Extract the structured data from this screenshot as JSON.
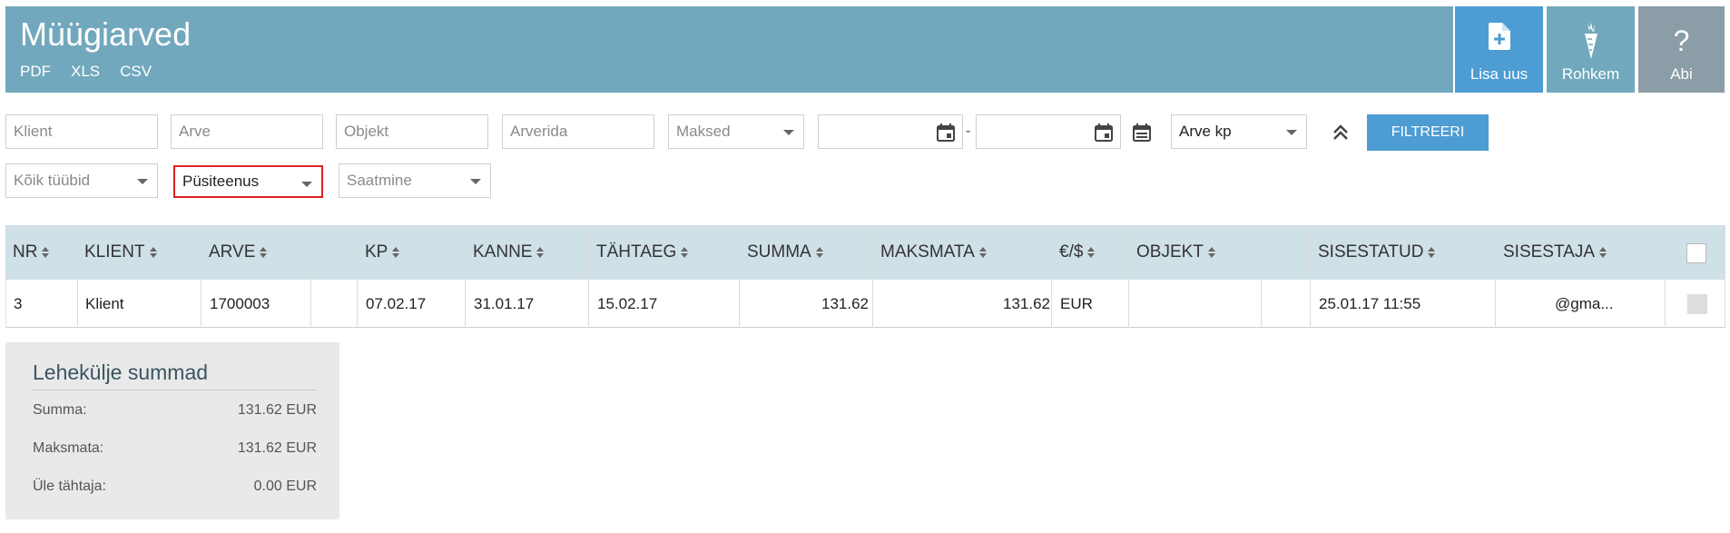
{
  "header": {
    "title": "Müügiarved",
    "exports": [
      "PDF",
      "XLS",
      "CSV"
    ],
    "buttons": {
      "add": "Lisa uus",
      "more": "Rohkem",
      "help": "Abi",
      "help_icon": "?"
    }
  },
  "filters": {
    "klient_placeholder": "Klient",
    "arve_placeholder": "Arve",
    "objekt_placeholder": "Objekt",
    "arverida_placeholder": "Arverida",
    "maksed": "Maksed",
    "date_separator": "-",
    "date_type": "Arve kp",
    "submit": "FILTREERI",
    "type": "Kõik tüübid",
    "service": "Püsiteenus",
    "saatmine": "Saatmine"
  },
  "table": {
    "columns": [
      "NR",
      "KLIENT",
      "ARVE",
      "",
      "KP",
      "KANNE",
      "TÄHTAEG",
      "SUMMA",
      "MAKSMATA",
      "€/$",
      "OBJEKT",
      "",
      "SISESTATUD",
      "SISESTAJA"
    ],
    "row": {
      "nr": "3",
      "klient": "Klient",
      "arve": "1700003",
      "kp": "07.02.17",
      "kanne": "31.01.17",
      "tahtaeg": "15.02.17",
      "summa": "131.62",
      "maksmata": "131.62",
      "valuuta": "EUR",
      "objekt": "",
      "sisestatud": "25.01.17 11:55",
      "sisestaja": "@gma..."
    }
  },
  "summary": {
    "title": "Lehekülje summad",
    "rows": [
      {
        "label": "Summa:",
        "value": "131.62 EUR"
      },
      {
        "label": "Maksmata:",
        "value": "131.62 EUR"
      },
      {
        "label": "Üle tähtaja:",
        "value": "0.00 EUR"
      }
    ]
  },
  "colors": {
    "header_bg": "#72a8bd",
    "add_button": "#4d9cd3",
    "help_button": "#8b9da6",
    "table_header_bg": "#cfe0e7",
    "highlight_border": "#dd2222"
  }
}
